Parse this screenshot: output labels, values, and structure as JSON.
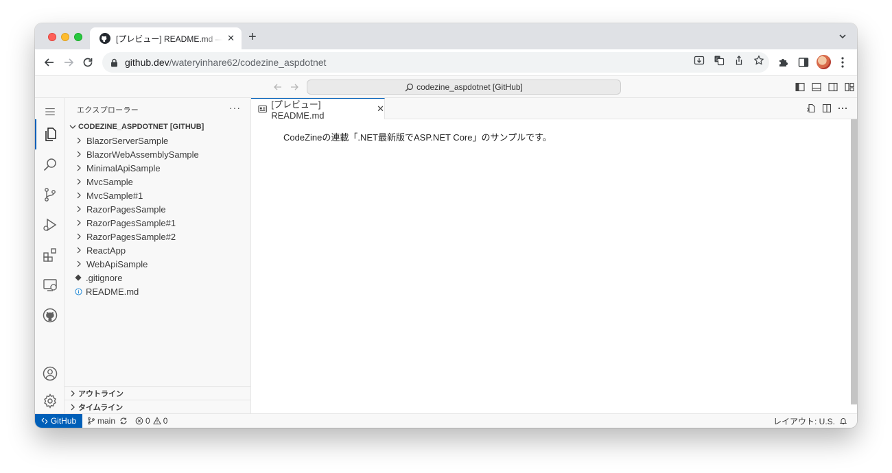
{
  "browser": {
    "tab_title": "[プレビュー] README.md — codezine_aspdotnet",
    "tab_close": "✕",
    "new_tab": "+",
    "url_domain": "github.dev",
    "url_path": "/wateryinhare62/codezine_aspdotnet"
  },
  "vscode": {
    "command_center": "codezine_aspdotnet [GitHub]",
    "explorer_title": "エクスプローラー",
    "more_actions": "···",
    "repo_section": "CODEZINE_ASPDOTNET [GITHUB]",
    "tree": [
      {
        "label": "BlazorServerSample",
        "kind": "folder"
      },
      {
        "label": "BlazorWebAssemblySample",
        "kind": "folder"
      },
      {
        "label": "MinimalApiSample",
        "kind": "folder"
      },
      {
        "label": "MvcSample",
        "kind": "folder"
      },
      {
        "label": "MvcSample#1",
        "kind": "folder"
      },
      {
        "label": "RazorPagesSample",
        "kind": "folder"
      },
      {
        "label": "RazorPagesSample#1",
        "kind": "folder"
      },
      {
        "label": "RazorPagesSample#2",
        "kind": "folder"
      },
      {
        "label": "ReactApp",
        "kind": "folder"
      },
      {
        "label": "WebApiSample",
        "kind": "folder"
      },
      {
        "label": ".gitignore",
        "kind": "git-file"
      },
      {
        "label": "README.md",
        "kind": "info-file"
      }
    ],
    "outline_section": "アウトライン",
    "timeline_section": "タイムライン",
    "editor_tab": "[プレビュー] README.md",
    "editor_tab_close": "✕",
    "preview_text": "CodeZineの連載「.NET最新版でASP.NET Core」のサンプルです。",
    "status": {
      "remote": "GitHub",
      "branch": "main",
      "errors": "0",
      "warnings": "0",
      "layout": "レイアウト: U.S."
    }
  },
  "colors": {
    "accent": "#005fb8",
    "scrollbar": "#c4c4c4",
    "tabstrip": "#dfe1e5"
  }
}
